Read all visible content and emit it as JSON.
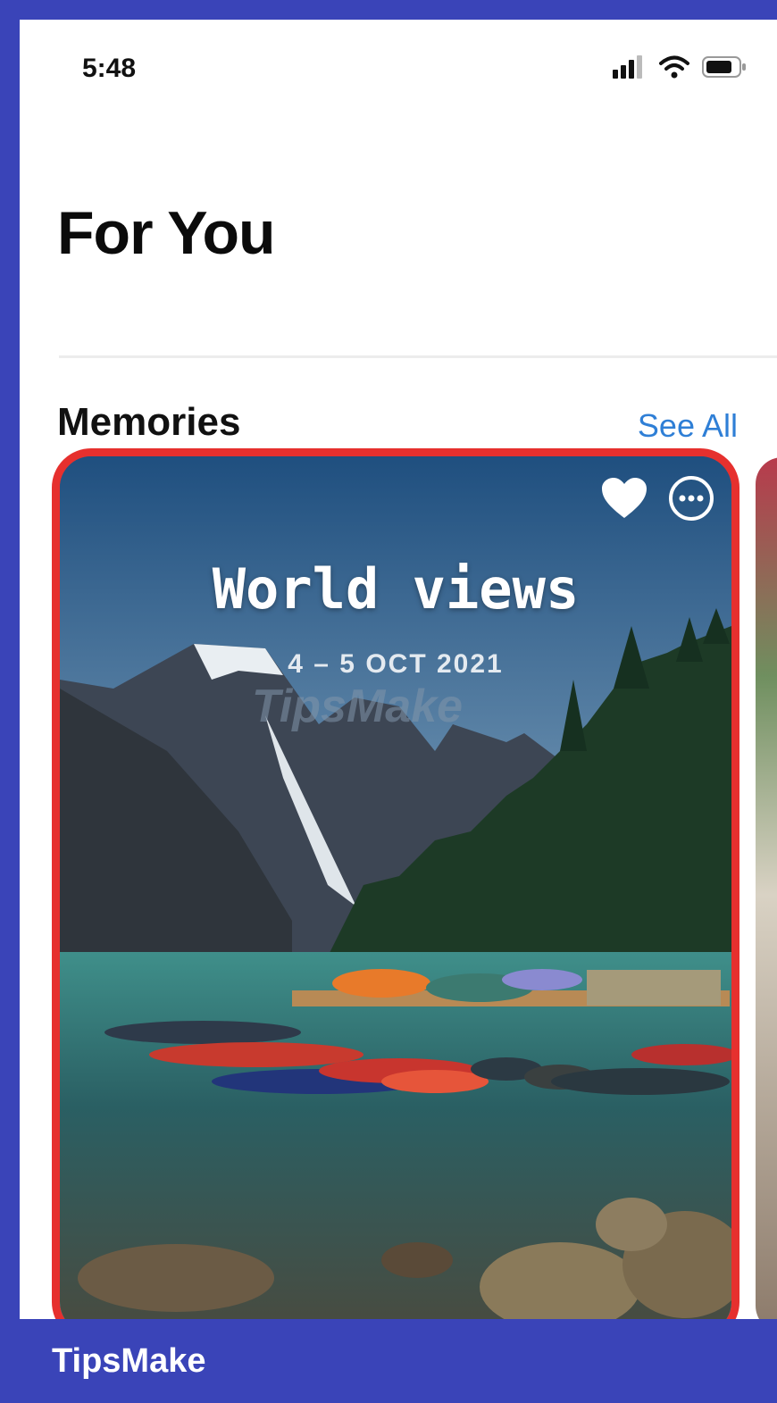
{
  "status_bar": {
    "time": "5:48",
    "icons": [
      "signal-icon",
      "wifi-icon",
      "battery-icon"
    ]
  },
  "header": {
    "title": "For You"
  },
  "memories": {
    "section_title": "Memories",
    "see_all_label": "See All",
    "see_all_color": "#2f7fd6",
    "card": {
      "title": "World views",
      "date": "4 – 5 OCT 2021",
      "watermark": "TipsMake",
      "highlight_color": "#e6302e",
      "icons": [
        "heart-icon",
        "more-icon"
      ]
    }
  },
  "brand": {
    "name": "TipsMake",
    "bar_color": "#3a44b8"
  }
}
